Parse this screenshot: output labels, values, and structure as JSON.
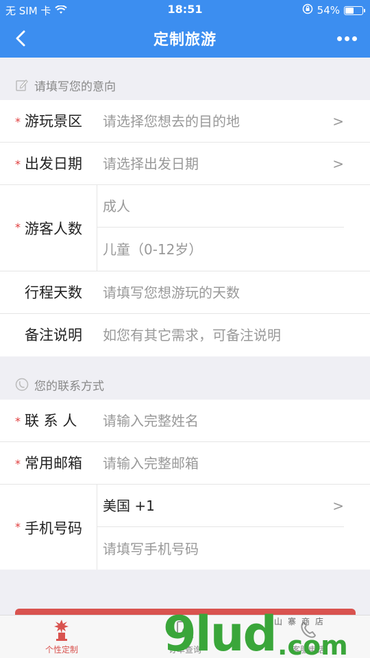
{
  "status_bar": {
    "carrier": "无 SIM 卡",
    "time": "18:51",
    "battery": "54%",
    "battery_level": 0.54
  },
  "nav": {
    "title": "定制旅游"
  },
  "section_intent": {
    "title": "请填写您的意向",
    "icon": "edit-icon"
  },
  "intent_fields": {
    "scenic": {
      "label": "游玩景区",
      "placeholder": "请选择您想去的目的地",
      "chevron": ">"
    },
    "date": {
      "label": "出发日期",
      "placeholder": "请选择出发日期",
      "chevron": ">"
    },
    "visitors": {
      "label": "游客人数",
      "adult": "成人",
      "child": "儿童（0-12岁）"
    },
    "days": {
      "label": "行程天数",
      "placeholder": "请填写您想游玩的天数"
    },
    "remarks": {
      "label": "备注说明",
      "placeholder": "如您有其它需求，可备注说明"
    }
  },
  "section_contact": {
    "title": "您的联系方式",
    "icon": "phone-circle-icon"
  },
  "contact_fields": {
    "name": {
      "label": "联 系 人",
      "placeholder": "请输入完整姓名"
    },
    "email": {
      "label": "常用邮箱",
      "placeholder": "请输入完整邮箱"
    },
    "phone": {
      "label": "手机号码",
      "country": "美国 +1",
      "chevron": ">",
      "placeholder": "请填写手机号码"
    }
  },
  "required_mark": "*",
  "tabbar": {
    "tabs": [
      {
        "label": "个性定制",
        "icon": "statue-icon",
        "active": true
      },
      {
        "label": "订单查询",
        "icon": "search-doc-icon",
        "active": false
      },
      {
        "label": "客服电话",
        "icon": "phone-icon",
        "active": false
      }
    ]
  },
  "watermark": {
    "brand": "9lud",
    "suffix": ".com",
    "small": "山寨商店"
  },
  "colors": {
    "header": "#3c8ef0",
    "required": "#e03c3c",
    "submit": "#d9534f"
  }
}
